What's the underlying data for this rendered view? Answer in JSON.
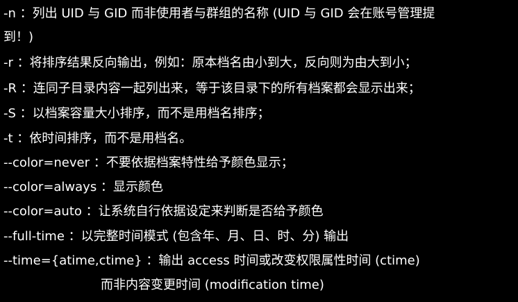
{
  "terminal": {
    "background": "#000000",
    "text_color": "#ffffff",
    "lines": [
      "-n ：列出 UID 与 GID 而非使用者与群组的名称 (UID 与 GID 会在账号管理提",
      "到！)",
      "-r ：将排序结果反向输出，例如：原本档名由小到大，反向则为由大到小；",
      "-R ：连同子目录内容一起列出来，等于该目录下的所有档案都会显示出来；",
      "-S ：以档案容量大小排序，而不是用档名排序；",
      "-t ：依时间排序，而不是用档名。",
      "--color=never ：不要依据档案特性给予颜色显示；",
      "--color=always ：显示颜色",
      "--color=auto ：让系统自行依据设定来判断是否给予颜色",
      "--full-time ：以完整时间模式 (包含年、月、日、时、分) 输出",
      "--time={atime,ctime} ：输出 access 时间或改变权限属性时间 (ctime)",
      "而非内容变更时间 (modification time)"
    ]
  }
}
